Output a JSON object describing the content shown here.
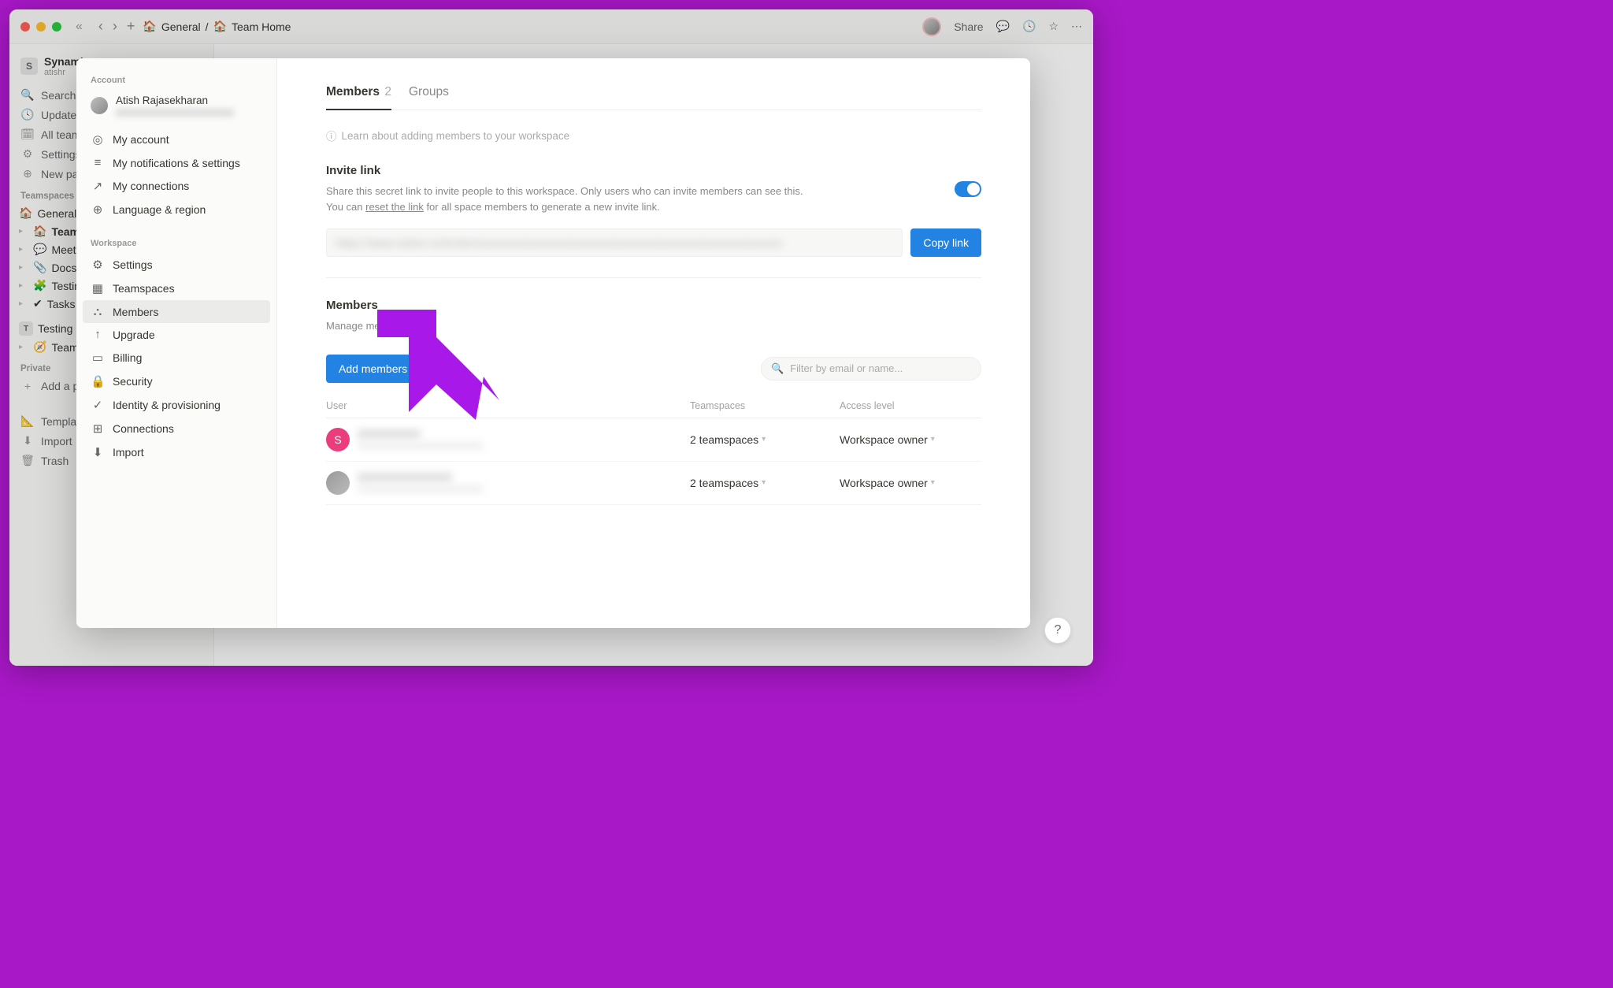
{
  "titlebar": {
    "crumb1_icon": "🏠",
    "crumb1": "General",
    "sep": "/",
    "crumb2_icon": "🏠",
    "crumb2": "Team Home",
    "share": "Share"
  },
  "bg_sidebar": {
    "workspace_initial": "S",
    "workspace_name": "Synamic",
    "workspace_sub": "atishr",
    "items": [
      {
        "icon": "🔍",
        "label": "Search"
      },
      {
        "icon": "🕓",
        "label": "Updates"
      },
      {
        "icon": "🗓",
        "label": "All teamspaces"
      },
      {
        "icon": "⚙",
        "label": "Settings"
      },
      {
        "icon": "⊕",
        "label": "New page"
      }
    ],
    "section1": "Teamspaces",
    "pages1": [
      {
        "icon": "🏠",
        "label": "General"
      },
      {
        "icon": "🏠",
        "label": "Team Home"
      },
      {
        "icon": "💬",
        "label": "Meetings"
      },
      {
        "icon": "📎",
        "label": "Docs"
      },
      {
        "icon": "🧩",
        "label": "Testing"
      },
      {
        "icon": "✔",
        "label": "Tasks"
      }
    ],
    "test_badge": "T",
    "test_label": "Testing",
    "team_label": "Team",
    "section2": "Private",
    "add_page": "Add a page",
    "bottom": [
      {
        "icon": "📐",
        "label": "Templates"
      },
      {
        "icon": "⬇",
        "label": "Import"
      },
      {
        "icon": "🗑",
        "label": "Trash"
      }
    ]
  },
  "modal_side": {
    "hdr1": "Account",
    "user_name": "Atish Rajasekharan",
    "account_items": [
      {
        "icon": "◎",
        "label": "My account"
      },
      {
        "icon": "≡",
        "label": "My notifications & settings"
      },
      {
        "icon": "↗",
        "label": "My connections"
      },
      {
        "icon": "⊕",
        "label": "Language & region"
      }
    ],
    "hdr2": "Workspace",
    "workspace_items": [
      {
        "icon": "⚙",
        "label": "Settings"
      },
      {
        "icon": "▦",
        "label": "Teamspaces"
      },
      {
        "icon": "⛬",
        "label": "Members"
      },
      {
        "icon": "↑",
        "label": "Upgrade"
      },
      {
        "icon": "▭",
        "label": "Billing"
      },
      {
        "icon": "🔒",
        "label": "Security"
      },
      {
        "icon": "✓",
        "label": "Identity & provisioning"
      },
      {
        "icon": "⊞",
        "label": "Connections"
      },
      {
        "icon": "⬇",
        "label": "Import"
      }
    ]
  },
  "main": {
    "tab_members": "Members",
    "tab_members_count": "2",
    "tab_groups": "Groups",
    "info": "Learn about adding members to your workspace",
    "invite_title": "Invite link",
    "invite_desc1": "Share this secret link to invite people to this workspace. Only users who can invite members can see this. You can ",
    "invite_reset": "reset the link",
    "invite_desc2": " for all space members to generate a new invite link.",
    "copy_btn": "Copy link",
    "members_title": "Members",
    "members_desc": "Manage members here.",
    "add_btn": "Add members",
    "filter_placeholder": "Filter by email or name...",
    "col_user": "User",
    "col_ts": "Teamspaces",
    "col_acc": "Access level",
    "rows": [
      {
        "avatar_letter": "S",
        "avatar_class": "pink",
        "teamspaces": "2 teamspaces",
        "access": "Workspace owner"
      },
      {
        "avatar_letter": "",
        "avatar_class": "img",
        "teamspaces": "2 teamspaces",
        "access": "Workspace owner"
      }
    ]
  }
}
